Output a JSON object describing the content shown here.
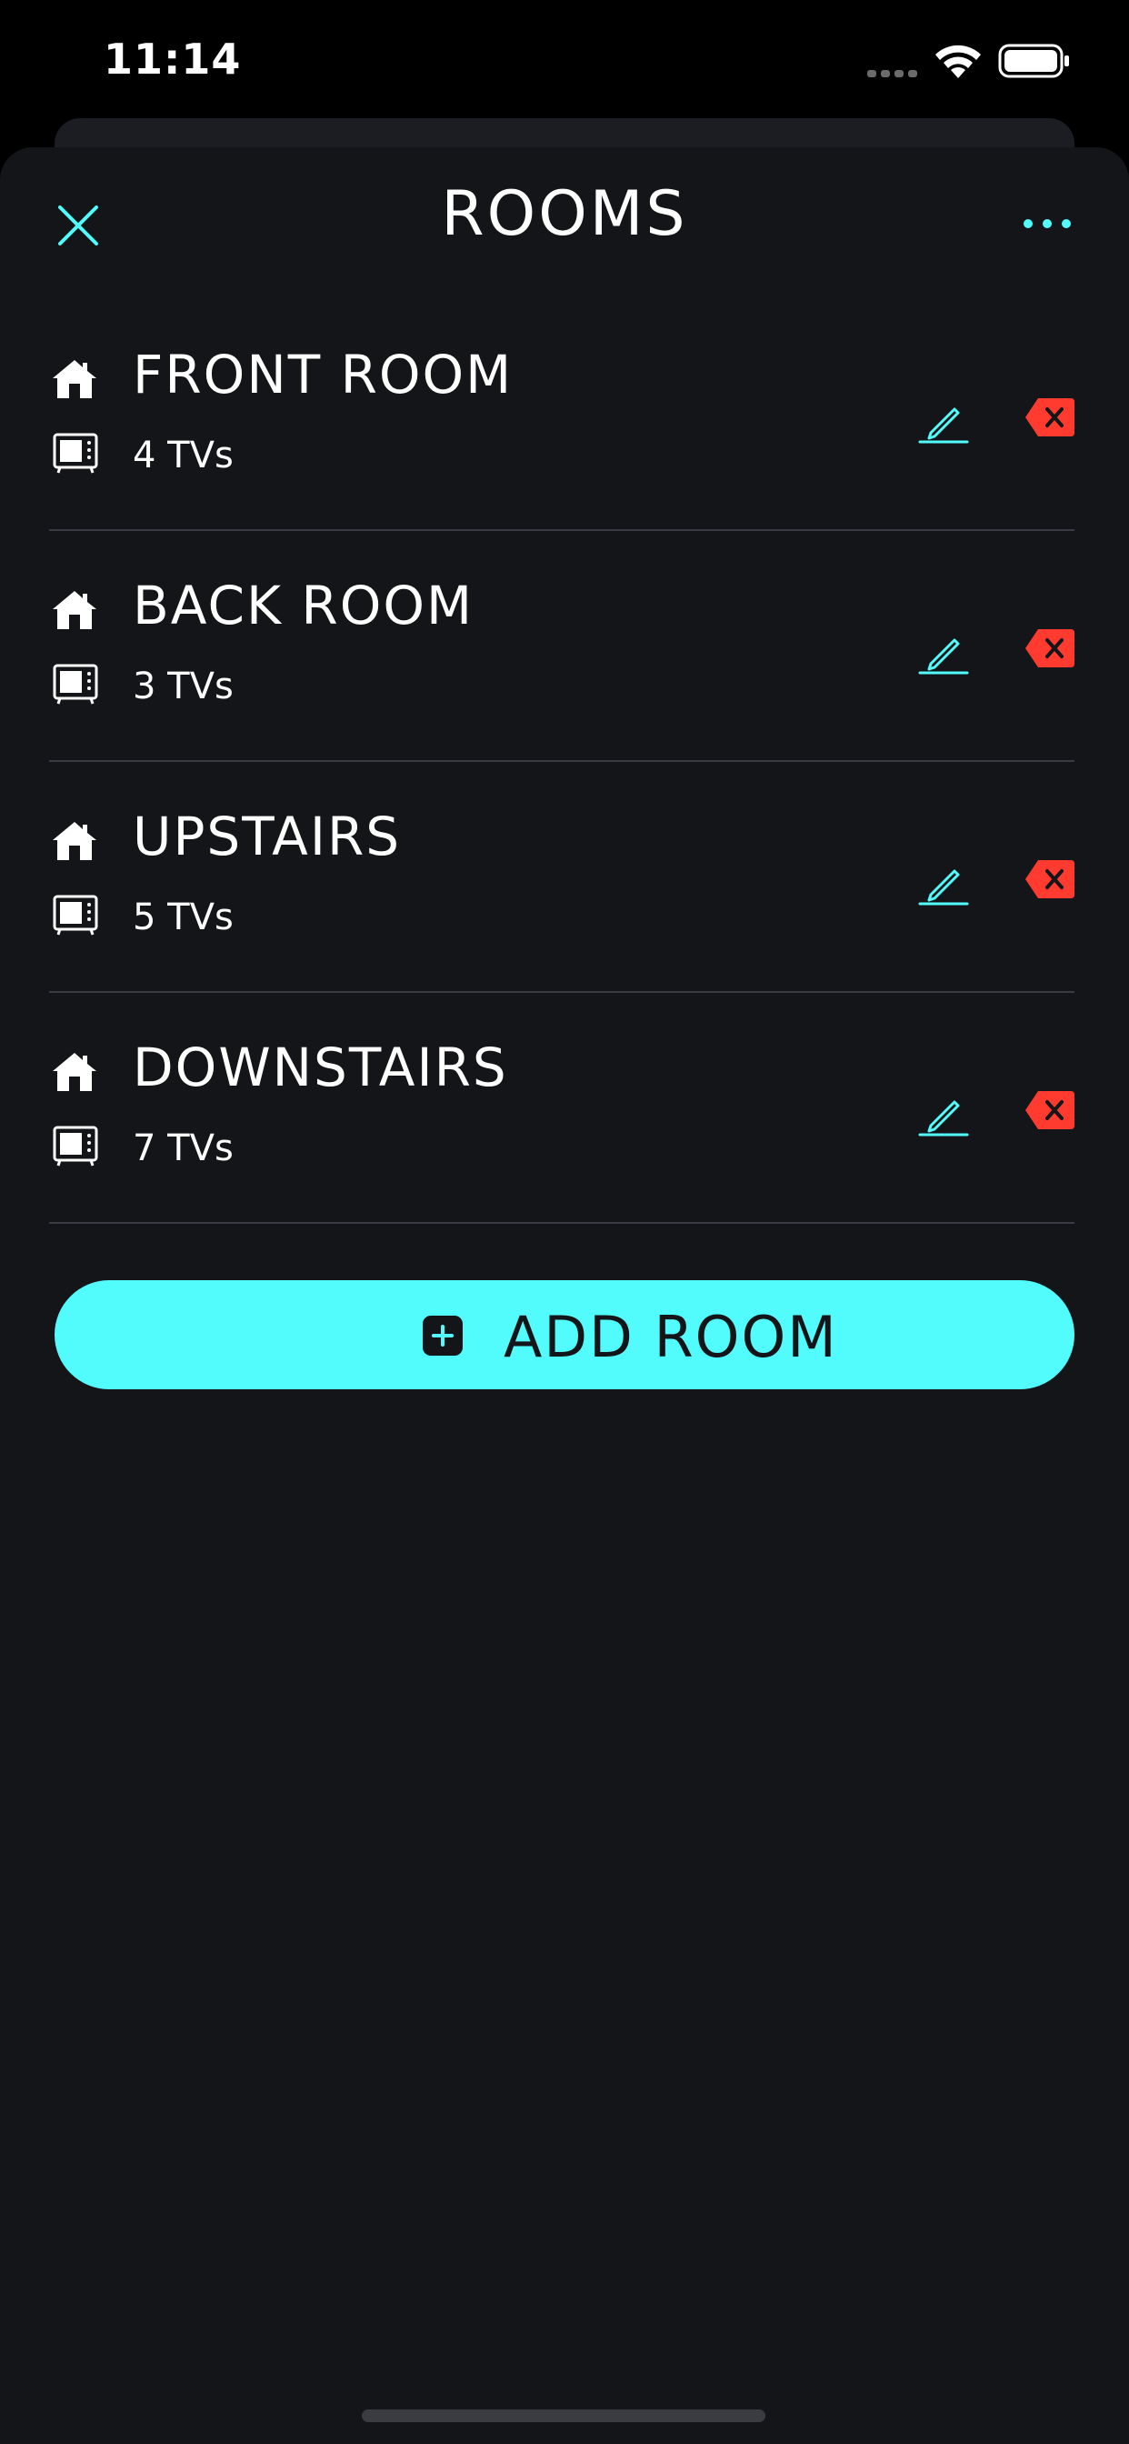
{
  "status_bar": {
    "time": "11:14"
  },
  "header": {
    "title": "ROOMS"
  },
  "rooms": [
    {
      "name": "FRONT ROOM",
      "tv_count": "4 TVs"
    },
    {
      "name": "BACK ROOM",
      "tv_count": "3 TVs"
    },
    {
      "name": "UPSTAIRS",
      "tv_count": "5 TVs"
    },
    {
      "name": "DOWNSTAIRS",
      "tv_count": "7 TVs"
    }
  ],
  "add_room": {
    "label": "ADD ROOM"
  },
  "icons": {
    "close": "close-icon",
    "more": "more-dots-icon",
    "room": "house-icon",
    "tv": "tv-icon",
    "edit": "pencil-icon",
    "delete": "backspace-delete-icon",
    "add": "plus-square-icon"
  },
  "colors": {
    "accent": "#52fcfc",
    "delete": "#ff3b30",
    "background": "#141519"
  }
}
